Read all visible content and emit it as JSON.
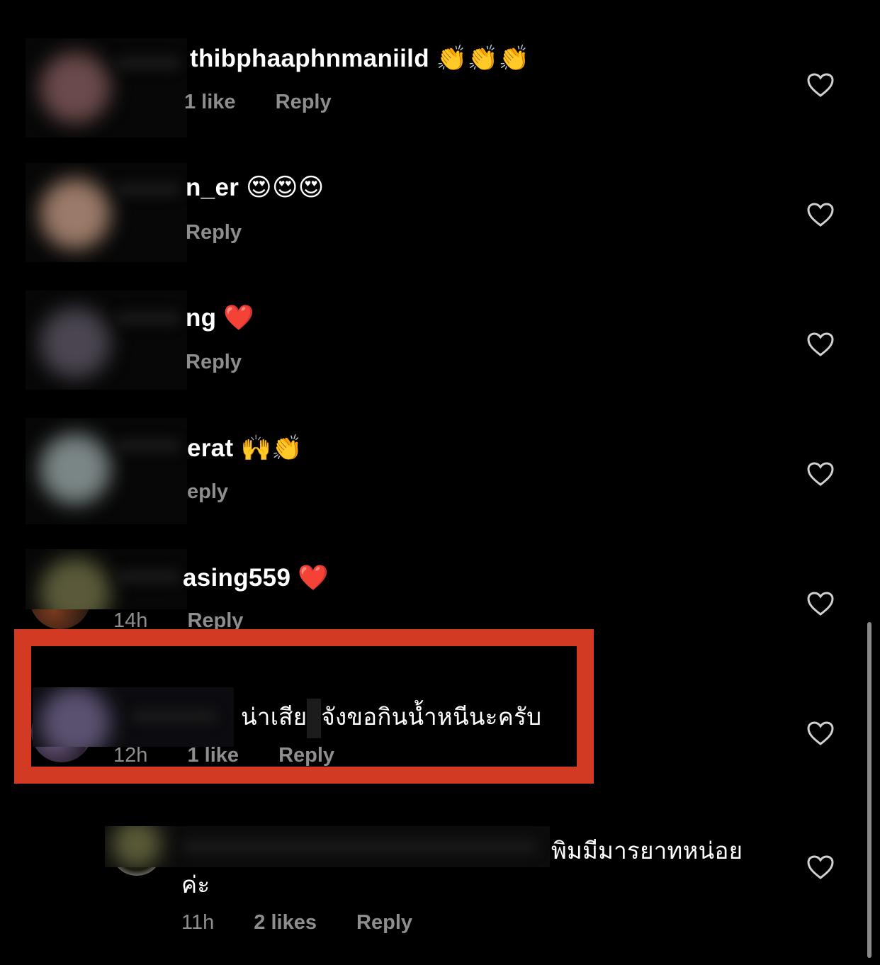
{
  "comments": [
    {
      "text": "thibphaaphnmaniild",
      "emoji": "👏👏👏",
      "time": "",
      "likes": "1 like",
      "reply": "Reply"
    },
    {
      "text": "n_er",
      "emoji": "😍😍😍",
      "time": "",
      "likes": "",
      "reply": "Reply"
    },
    {
      "text": "ng",
      "emoji": "❤️",
      "time": "",
      "likes": "",
      "reply": "Reply"
    },
    {
      "text": "erat",
      "emoji": "🙌👏",
      "time": "",
      "likes": "",
      "reply": "eply"
    },
    {
      "text": "asing559",
      "emoji": "❤️",
      "time": "14h",
      "likes": "",
      "reply": "Reply"
    },
    {
      "text_before": "น่าเสีย",
      "text_after": "จังขอกินน้ำหนีนะครับ",
      "time": "12h",
      "likes": "1 like",
      "reply": "Reply"
    },
    {
      "text_line1": "พิมมีมารยาทหน่อย",
      "text_line2": "ค่ะ",
      "time": "11h",
      "likes": "2 likes",
      "reply": "Reply"
    }
  ],
  "colors": {
    "background": "#000000",
    "text": "#ffffff",
    "meta": "#8e8e8e",
    "highlight_border": "#d23a24"
  },
  "icons": {
    "like": "heart-outline-icon"
  }
}
